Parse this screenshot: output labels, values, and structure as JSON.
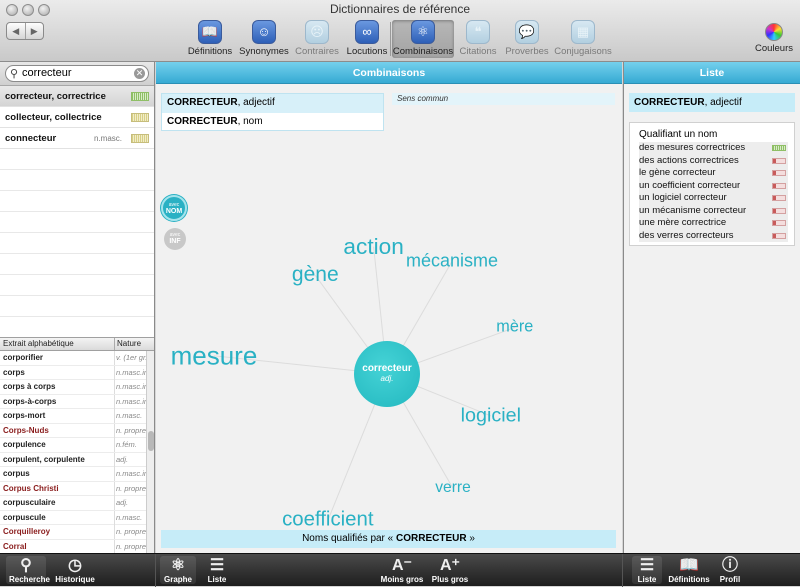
{
  "window": {
    "title": "Dictionnaires de référence"
  },
  "toolbar": {
    "tools": [
      {
        "label": "Définitions",
        "icon": "book-icon",
        "glyph": "📖",
        "state": "normal"
      },
      {
        "label": "Synonymes",
        "icon": "theater-masks-icon",
        "glyph": "☺",
        "state": "normal"
      },
      {
        "label": "Contraires",
        "icon": "contrary-masks-icon",
        "glyph": "☹",
        "state": "dim"
      },
      {
        "label": "Locutions",
        "icon": "chain-link-icon",
        "glyph": "∞",
        "state": "normal"
      },
      {
        "label": "Combinaisons",
        "icon": "atom-icon",
        "glyph": "⚛",
        "state": "active"
      },
      {
        "label": "Citations",
        "icon": "quote-icon",
        "glyph": "❝",
        "state": "dim"
      },
      {
        "label": "Proverbes",
        "icon": "speech-bubble-icon",
        "glyph": "💬",
        "state": "dim"
      },
      {
        "label": "Conjugaisons",
        "icon": "conjugation-table-icon",
        "glyph": "▦",
        "state": "dim"
      }
    ],
    "colors_label": "Couleurs"
  },
  "search": {
    "value": "correcteur"
  },
  "results": [
    {
      "word": "correcteur, correctrice",
      "nature": "",
      "selected": true,
      "bars": "green"
    },
    {
      "word": "collecteur, collectrice",
      "nature": "",
      "selected": false,
      "bars": "yellow"
    },
    {
      "word": "connecteur",
      "nature": "n.masc.",
      "selected": false,
      "bars": "yellow"
    }
  ],
  "alpha": {
    "header_word": "Extrait alphabétique",
    "header_nature": "Nature",
    "rows": [
      {
        "word": "corporifier",
        "nature": "v. (1er gr.)",
        "proper": false
      },
      {
        "word": "corps",
        "nature": "n.masc.inv.",
        "proper": false
      },
      {
        "word": "corps à corps",
        "nature": "n.masc.inv.",
        "proper": false
      },
      {
        "word": "corps-à-corps",
        "nature": "n.masc.inv.",
        "proper": false
      },
      {
        "word": "corps-mort",
        "nature": "n.masc.",
        "proper": false
      },
      {
        "word": "Corps-Nuds",
        "nature": "n. propre",
        "proper": true
      },
      {
        "word": "corpulence",
        "nature": "n.fém.",
        "proper": false
      },
      {
        "word": "corpulent, corpulente",
        "nature": "adj.",
        "proper": false
      },
      {
        "word": "corpus",
        "nature": "n.masc.inv.",
        "proper": false
      },
      {
        "word": "Corpus Christi",
        "nature": "n. propre",
        "proper": true
      },
      {
        "word": "corpusculaire",
        "nature": "adj.",
        "proper": false
      },
      {
        "word": "corpuscule",
        "nature": "n.masc.",
        "proper": false
      },
      {
        "word": "Corquilleroy",
        "nature": "n. propre",
        "proper": true
      },
      {
        "word": "Corral",
        "nature": "n. propre",
        "proper": true
      }
    ]
  },
  "center": {
    "header": "Combinaisons",
    "senses": [
      {
        "head": "CORRECTEUR",
        "rest": ", adjectif",
        "selected": true
      },
      {
        "head": "CORRECTEUR",
        "rest": ", nom",
        "selected": false
      }
    ],
    "sense_label": "Sens commun",
    "btn_nom": {
      "small": "avec",
      "label": "NOM"
    },
    "btn_inf": {
      "small": "avec",
      "label": "INF"
    },
    "center_word": "correcteur",
    "center_cat": "adj.",
    "caption_prefix": "Noms qualifiés par « ",
    "caption_word": "CORRECTEUR",
    "caption_suffix": " »"
  },
  "graph_nodes": [
    {
      "word": "action",
      "weight": 0.79
    },
    {
      "word": "mécanisme",
      "weight": 0.5
    },
    {
      "word": "mère",
      "weight": 0.39
    },
    {
      "word": "logiciel",
      "weight": 0.61
    },
    {
      "word": "verre",
      "weight": 0.35
    },
    {
      "word": "coefficient",
      "weight": 0.65
    },
    {
      "word": "mesure",
      "weight": 1.0
    },
    {
      "word": "gène",
      "weight": 0.69
    }
  ],
  "right": {
    "header": "Liste",
    "sense_head": "CORRECTEUR",
    "sense_rest": ", adjectif",
    "heading": "Qualifiant un nom",
    "items": [
      {
        "text": "des mesures correctrices",
        "bar": "green"
      },
      {
        "text": "des actions correctrices",
        "bar": "red"
      },
      {
        "text": "le gène correcteur",
        "bar": "red"
      },
      {
        "text": "un coefficient correcteur",
        "bar": "red"
      },
      {
        "text": "un logiciel correcteur",
        "bar": "red"
      },
      {
        "text": "un mécanisme correcteur",
        "bar": "red"
      },
      {
        "text": "une mère correctrice",
        "bar": "red"
      },
      {
        "text": "des verres correcteurs",
        "bar": "red"
      }
    ]
  },
  "bottom": {
    "recherche": "Recherche",
    "historique": "Historique",
    "graphe": "Graphe",
    "liste": "Liste",
    "moins_gros": "Moins gros",
    "plus_gros": "Plus gros",
    "liste_r": "Liste",
    "definitions": "Définitions",
    "profil": "Profil"
  }
}
